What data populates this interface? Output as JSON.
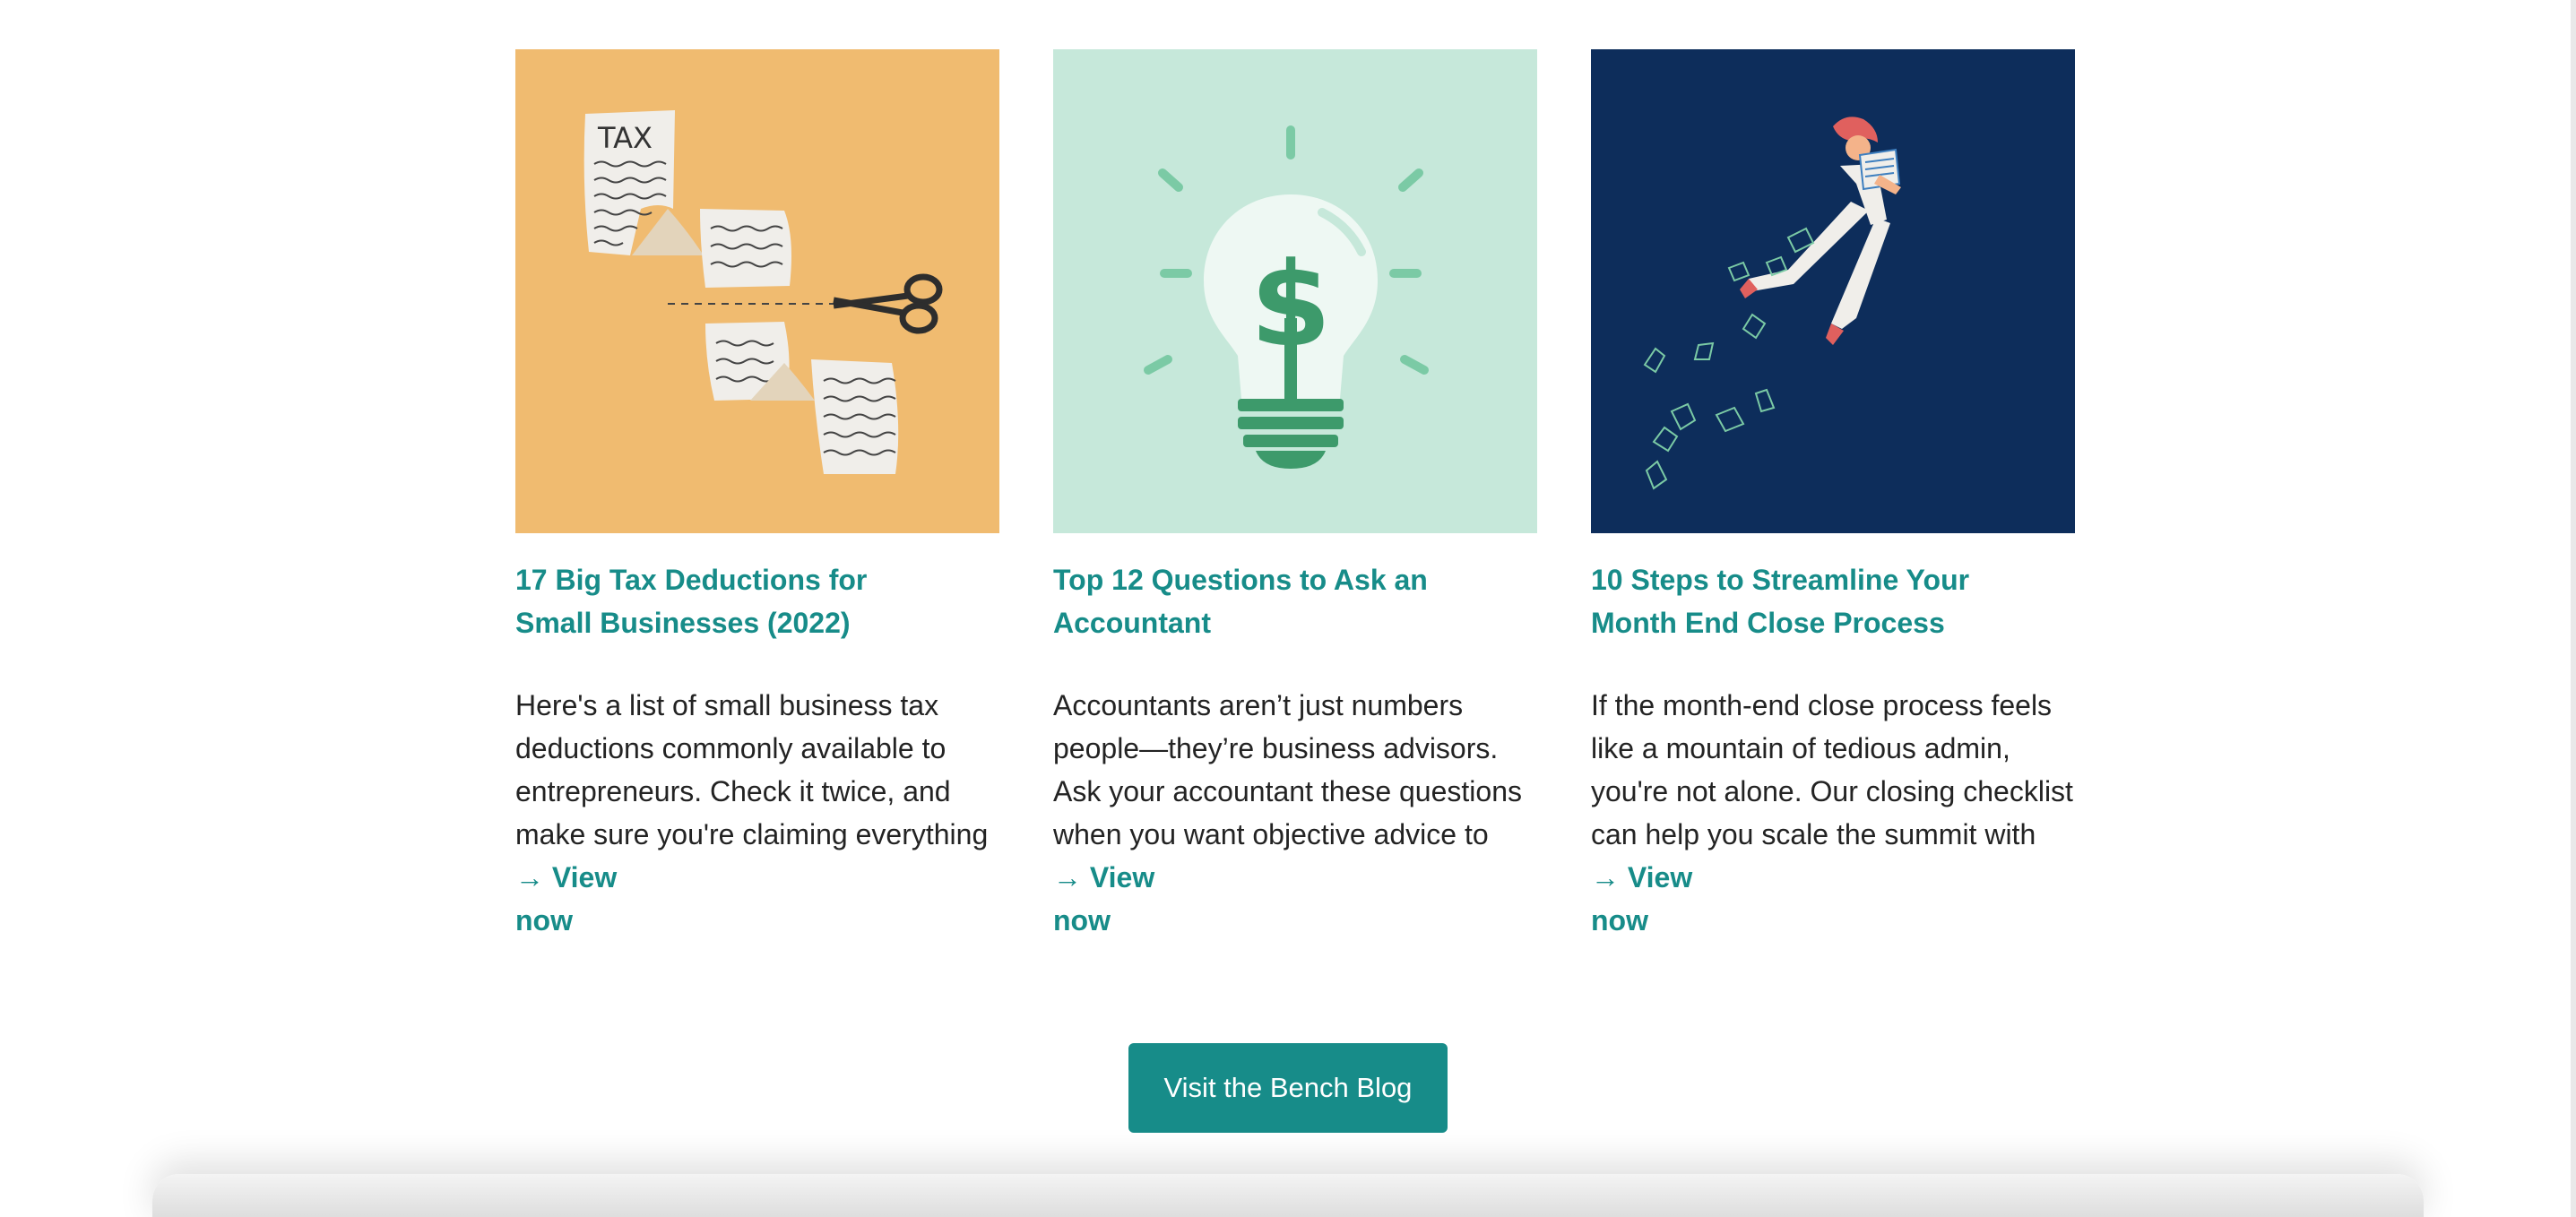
{
  "colors": {
    "accent": "#178c89",
    "text": "#232323",
    "card1_bg": "#f0bb70",
    "card2_bg": "#c6e8da",
    "card3_bg": "#0d2d5b"
  },
  "cards": [
    {
      "image_icon": "tax-receipt-scissors-illustration",
      "image_text": "TAX",
      "title": "17 Big Tax Deductions for Small Businesses (2022)",
      "description": "Here's a list of small business tax deductions commonly available to entrepreneurs. Check it twice, and make sure you're claiming everything you can.",
      "link": "→ View now"
    },
    {
      "image_icon": "lightbulb-dollar-illustration",
      "title": "Top 12 Questions to Ask an Accountant",
      "description": "Accountants aren’t just numbers people—they’re business advisors. Ask your accountant these questions when you want objective advice to grow your business.",
      "link": "→ View now"
    },
    {
      "image_icon": "woman-flying-papers-illustration",
      "title": "10 Steps to Streamline Your Month End Close Process",
      "description": "If the month-end close process feels like a mountain of tedious admin, you're not alone. Our closing checklist can help you scale the summit with ease.",
      "link": "→ View now"
    }
  ],
  "cta": {
    "label": "Visit the Bench Blog"
  }
}
